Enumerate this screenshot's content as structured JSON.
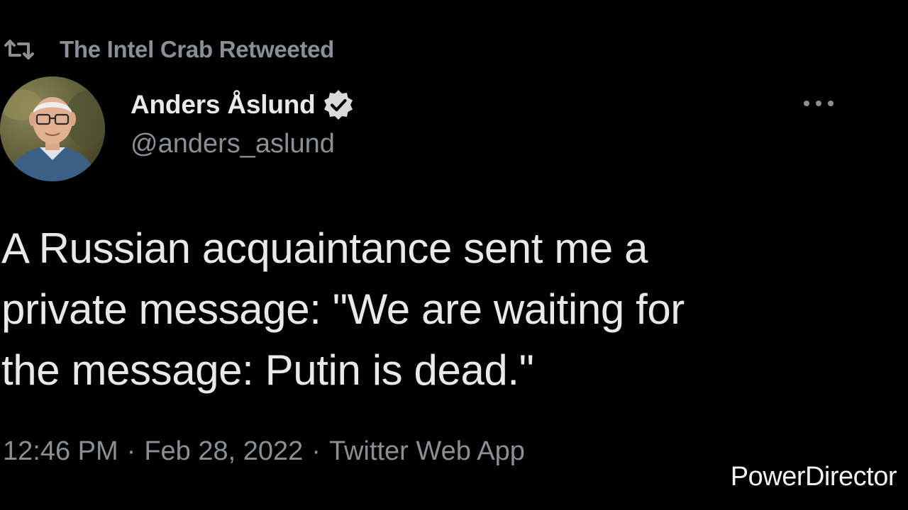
{
  "retweet": {
    "icon": "retweet-icon",
    "label": "The Intel Crab Retweeted"
  },
  "author": {
    "name": "Anders Åslund",
    "handle": "@anders_aslund",
    "verified": true,
    "verified_icon": "verified-check-icon",
    "avatar_icon": "avatar-photo"
  },
  "more_icon": "more-horizontal-icon",
  "tweet": {
    "lines": [
      "A Russian acquaintance sent me a",
      "private message: \"We are waiting for",
      "the message: Putin is dead.\""
    ]
  },
  "meta": {
    "time": "12:46 PM",
    "separator": "·",
    "date": "Feb 28, 2022",
    "source": "Twitter Web App"
  },
  "watermark": "PowerDirector",
  "colors": {
    "background": "#000000",
    "text_primary": "#e7e9ea",
    "text_secondary": "#8b8f94",
    "verified_badge": "#d9d9d9"
  }
}
